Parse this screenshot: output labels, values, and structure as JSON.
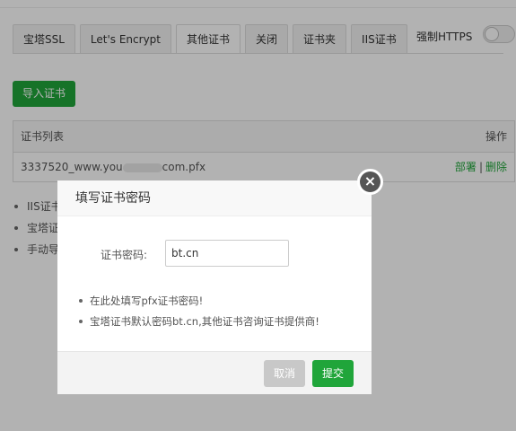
{
  "tabs": [
    {
      "label": "宝塔SSL"
    },
    {
      "label": "Let's Encrypt"
    },
    {
      "label": "其他证书"
    },
    {
      "label": "关闭"
    },
    {
      "label": "证书夹"
    },
    {
      "label": "IIS证书"
    }
  ],
  "header": {
    "https_label": "强制HTTPS",
    "https_enabled": false
  },
  "import_button": "导入证书",
  "table": {
    "columns": [
      "证书列表",
      "操作"
    ],
    "rows": [
      {
        "name_prefix": "3337520_www.you",
        "name_suffix": "com.pfx",
        "deploy": "部署",
        "separator": "|",
        "delete": "删除"
      }
    ]
  },
  "notes": [
    "IIS证书",
    "宝塔证",
    "手动导"
  ],
  "modal": {
    "title": "填写证书密码",
    "close_icon": "×",
    "field_label": "证书密码:",
    "field_value": "bt.cn",
    "tips": [
      "在此处填写pfx证书密码!",
      "宝塔证书默认密码bt.cn,其他证书咨询证书提供商!"
    ],
    "cancel_label": "取消",
    "submit_label": "提交"
  },
  "colors": {
    "accent": "#20a53a",
    "cancel": "#c8c8c8",
    "close": "#555555"
  }
}
